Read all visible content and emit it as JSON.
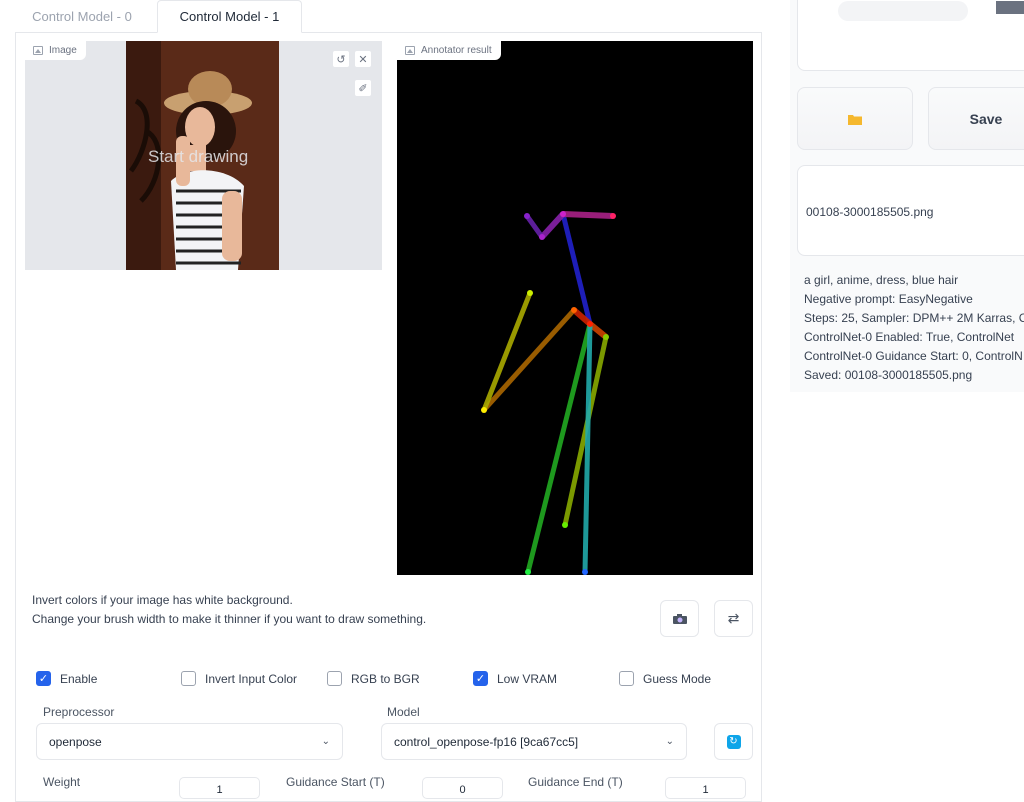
{
  "tabs": [
    {
      "label": "Control Model - 0"
    },
    {
      "label": "Control Model - 1"
    }
  ],
  "image_panel": {
    "label": "Image",
    "overlay_text": "Start drawing"
  },
  "annotator_panel": {
    "label": "Annotator result"
  },
  "help_text": {
    "line1": "Invert colors if your image has white background.",
    "line2": "Change your brush width to make it thinner if you want to draw something."
  },
  "checkboxes": [
    {
      "label": "Enable",
      "checked": true
    },
    {
      "label": "Invert Input Color",
      "checked": false
    },
    {
      "label": "RGB to BGR",
      "checked": false
    },
    {
      "label": "Low VRAM",
      "checked": true
    },
    {
      "label": "Guess Mode",
      "checked": false
    }
  ],
  "preprocessor": {
    "label": "Preprocessor",
    "value": "openpose"
  },
  "model": {
    "label": "Model",
    "value": "control_openpose-fp16 [9ca67cc5]"
  },
  "weight": {
    "label": "Weight",
    "value": "1"
  },
  "guidance_start": {
    "label": "Guidance Start (T)",
    "value": "0"
  },
  "guidance_end": {
    "label": "Guidance End (T)",
    "value": "1"
  },
  "right": {
    "save_label": "Save",
    "filename": "00108-3000185505.png",
    "info_lines": [
      "a girl, anime, dress, blue hair",
      "Negative prompt: EasyNegative",
      "Steps: 25, Sampler: DPM++ 2M Karras, C",
      "ControlNet-0 Enabled: True, ControlNet",
      "ControlNet-0 Guidance Start: 0, ControlN",
      "Saved: 00108-3000185505.png"
    ]
  },
  "colors": {
    "accent": "#2563eb",
    "folder": "#f5b82e",
    "canvas_bg": "#e5e7eb",
    "annotator_bg": "#000000"
  }
}
